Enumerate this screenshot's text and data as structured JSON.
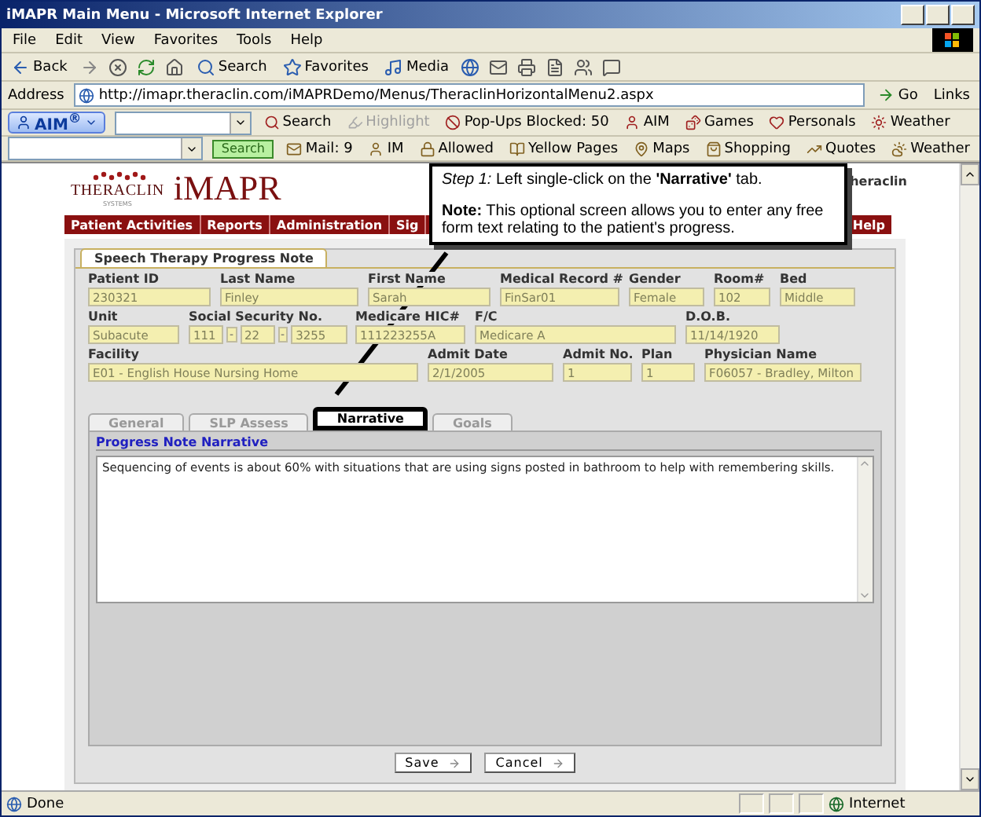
{
  "window": {
    "title": "iMAPR Main Menu - Microsoft Internet Explorer"
  },
  "menu_bar": [
    "File",
    "Edit",
    "View",
    "Favorites",
    "Tools",
    "Help"
  ],
  "toolbar": [
    {
      "kind": "back",
      "label": "Back"
    },
    {
      "kind": "search",
      "label": "Search"
    },
    {
      "kind": "favorites",
      "label": "Favorites"
    },
    {
      "kind": "media",
      "label": "Media"
    }
  ],
  "address_bar": {
    "label": "Address",
    "url": "http://imapr.theraclin.com/iMAPRDemo/Menus/TheraclinHorizontalMenu2.aspx",
    "go": "Go",
    "links": "Links"
  },
  "aim_toolbar": {
    "brand": "AIM$^{®}$",
    "items": [
      {
        "kind": "search",
        "label": "Search",
        "disabled": false
      },
      {
        "kind": "highlight",
        "label": "Highlight",
        "disabled": true
      },
      {
        "kind": "popups",
        "label": "Pop-Ups Blocked: 50",
        "disabled": false
      },
      {
        "kind": "aim",
        "label": "AIM",
        "disabled": false
      },
      {
        "kind": "games",
        "label": "Games",
        "disabled": false
      },
      {
        "kind": "personals",
        "label": "Personals",
        "disabled": false
      },
      {
        "kind": "weather",
        "label": "Weather",
        "disabled": false
      }
    ]
  },
  "search_toolbar": {
    "search_button": "Search",
    "items": [
      {
        "kind": "mail",
        "label": "Mail: 9"
      },
      {
        "kind": "im",
        "label": "IM"
      },
      {
        "kind": "allowed",
        "label": "Allowed"
      },
      {
        "kind": "pages",
        "label": "Yellow Pages"
      },
      {
        "kind": "maps",
        "label": "Maps"
      },
      {
        "kind": "shopping",
        "label": "Shopping"
      },
      {
        "kind": "quotes",
        "label": "Quotes"
      },
      {
        "kind": "weather",
        "label": "Weather"
      }
    ]
  },
  "app": {
    "logo_text": "THERACLIN",
    "logo_sub": "SYSTEMS",
    "product": "iMAPR",
    "user_fragment": "heraclin",
    "nav": [
      "Patient Activities",
      "Reports",
      "Administration",
      "Sig",
      "Help"
    ]
  },
  "form": {
    "title": "Speech Therapy Progress Note",
    "rows": [
      [
        {
          "kind": "text",
          "label": "Patient ID",
          "value": "230321"
        },
        {
          "kind": "text",
          "label": "Last Name",
          "value": "Finley"
        },
        {
          "kind": "text",
          "label": "First Name",
          "value": "Sarah"
        },
        {
          "kind": "text",
          "label": "Medical Record #",
          "value": "FinSar01"
        },
        {
          "kind": "text",
          "label": "Gender",
          "value": "Female"
        },
        {
          "kind": "text",
          "label": "Room#",
          "value": "102"
        },
        {
          "kind": "text",
          "label": "Bed",
          "value": "Middle"
        }
      ],
      [
        {
          "kind": "text",
          "label": "Unit",
          "value": "Subacute"
        },
        {
          "kind": "ssn",
          "label": "Social Security No.",
          "parts": [
            "111",
            "22",
            "3255"
          ],
          "separator": "-"
        },
        {
          "kind": "text",
          "label": "Medicare HIC#",
          "value": "111223255A"
        },
        {
          "kind": "text",
          "label": "F/C",
          "value": "Medicare A"
        },
        {
          "kind": "text",
          "label": "D.O.B.",
          "value": "11/14/1920"
        }
      ],
      [
        {
          "kind": "text",
          "label": "Facility",
          "value": "E01 - English House Nursing Home"
        },
        {
          "kind": "text",
          "label": "Admit Date",
          "value": "2/1/2005"
        },
        {
          "kind": "text",
          "label": "Admit No.",
          "value": "1"
        },
        {
          "kind": "text",
          "label": "Plan",
          "value": "1"
        },
        {
          "kind": "text",
          "label": "Physician Name",
          "value": "F06057 - Bradley, Milton"
        }
      ]
    ],
    "tabs": [
      {
        "label": "General",
        "selected": false
      },
      {
        "label": "SLP Assess",
        "selected": false
      },
      {
        "label": "Narrative",
        "selected": true
      },
      {
        "label": "Goals",
        "selected": false
      }
    ],
    "section_title": "Progress Note Narrative",
    "narrative": "Sequencing of events is about 60% with situations that are using signs posted in bathroom to help with remembering skills.",
    "buttons": [
      "Save",
      "Cancel"
    ]
  },
  "callout": {
    "step": "*Step 1:* Left single-click on the **'Narrative'** tab.",
    "note": "**Note:** This optional screen allows you to enter any free form text relating to the patient's progress."
  },
  "status_bar": {
    "status": "Done",
    "zone": "Internet"
  }
}
